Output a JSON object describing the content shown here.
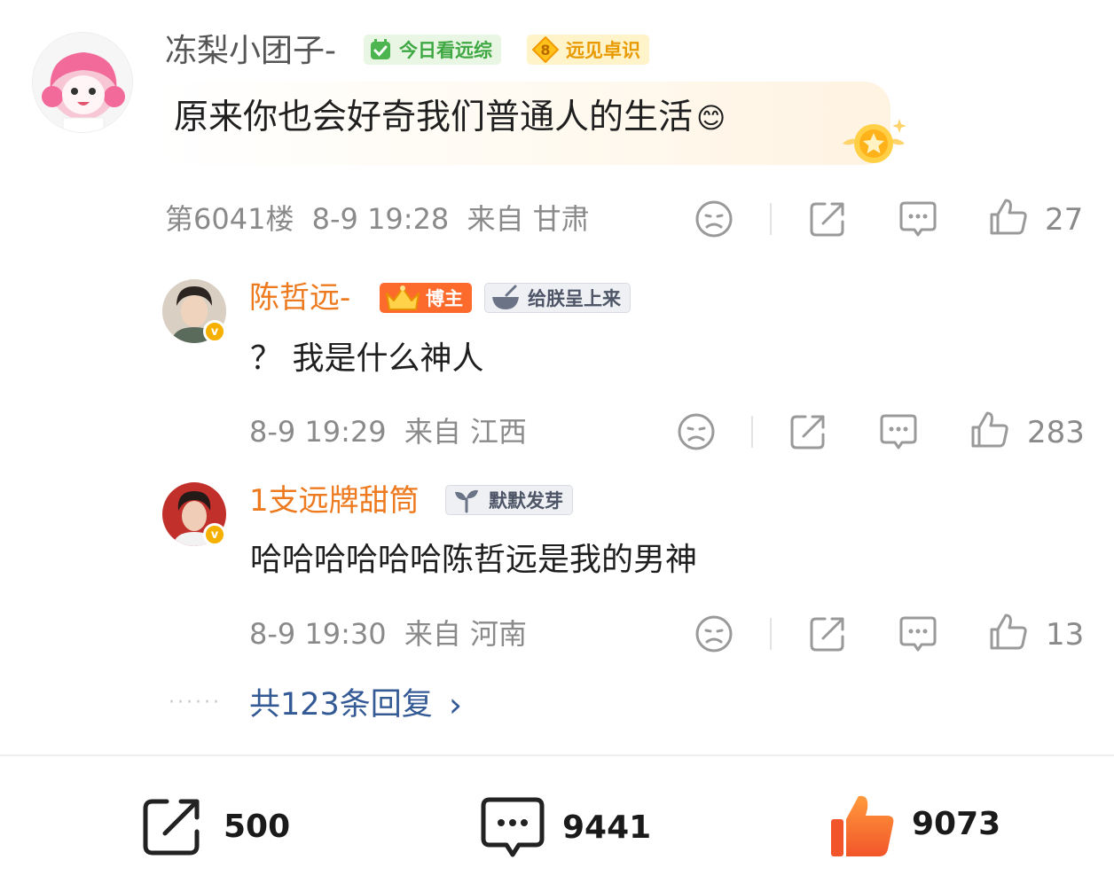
{
  "main_comment": {
    "username": "冻梨小团子-",
    "badges": [
      {
        "icon": "check-square-icon",
        "label": "今日看远综"
      },
      {
        "icon": "level-diamond-icon",
        "level": "8",
        "label": "远见卓识"
      }
    ],
    "text": "原来你也会好奇我们普通人的生活",
    "emoji": "😊",
    "floor": "第6041楼",
    "time": "8-9 19:28",
    "location": "来自 甘肃",
    "likes": "27"
  },
  "replies": [
    {
      "username": "陈哲远-",
      "badges": [
        {
          "icon": "crown-icon",
          "label": "博主"
        },
        {
          "icon": "bowl-icon",
          "label": "给朕呈上来"
        }
      ],
      "text": "？ 我是什么神人",
      "time": "8-9 19:29",
      "location": "来自 江西",
      "likes": "283",
      "verified": "v"
    },
    {
      "username": "1支远牌甜筒",
      "badges": [
        {
          "icon": "sprout-icon",
          "label": "默默发芽"
        }
      ],
      "text": "哈哈哈哈哈哈陈哲远是我的男神",
      "time": "8-9 19:30",
      "location": "来自 河南",
      "likes": "13",
      "verified": "v"
    }
  ],
  "more_replies": {
    "dots": "······",
    "label": "共123条回复",
    "chevron": "›"
  },
  "bottom_bar": {
    "share_count": "500",
    "comment_count": "9441",
    "like_count": "9073"
  },
  "colors": {
    "username_orange": "#ee7a1f",
    "link_blue": "#345a96",
    "meta_grey": "#8a8a8a",
    "like_active": "#f56b2a"
  }
}
